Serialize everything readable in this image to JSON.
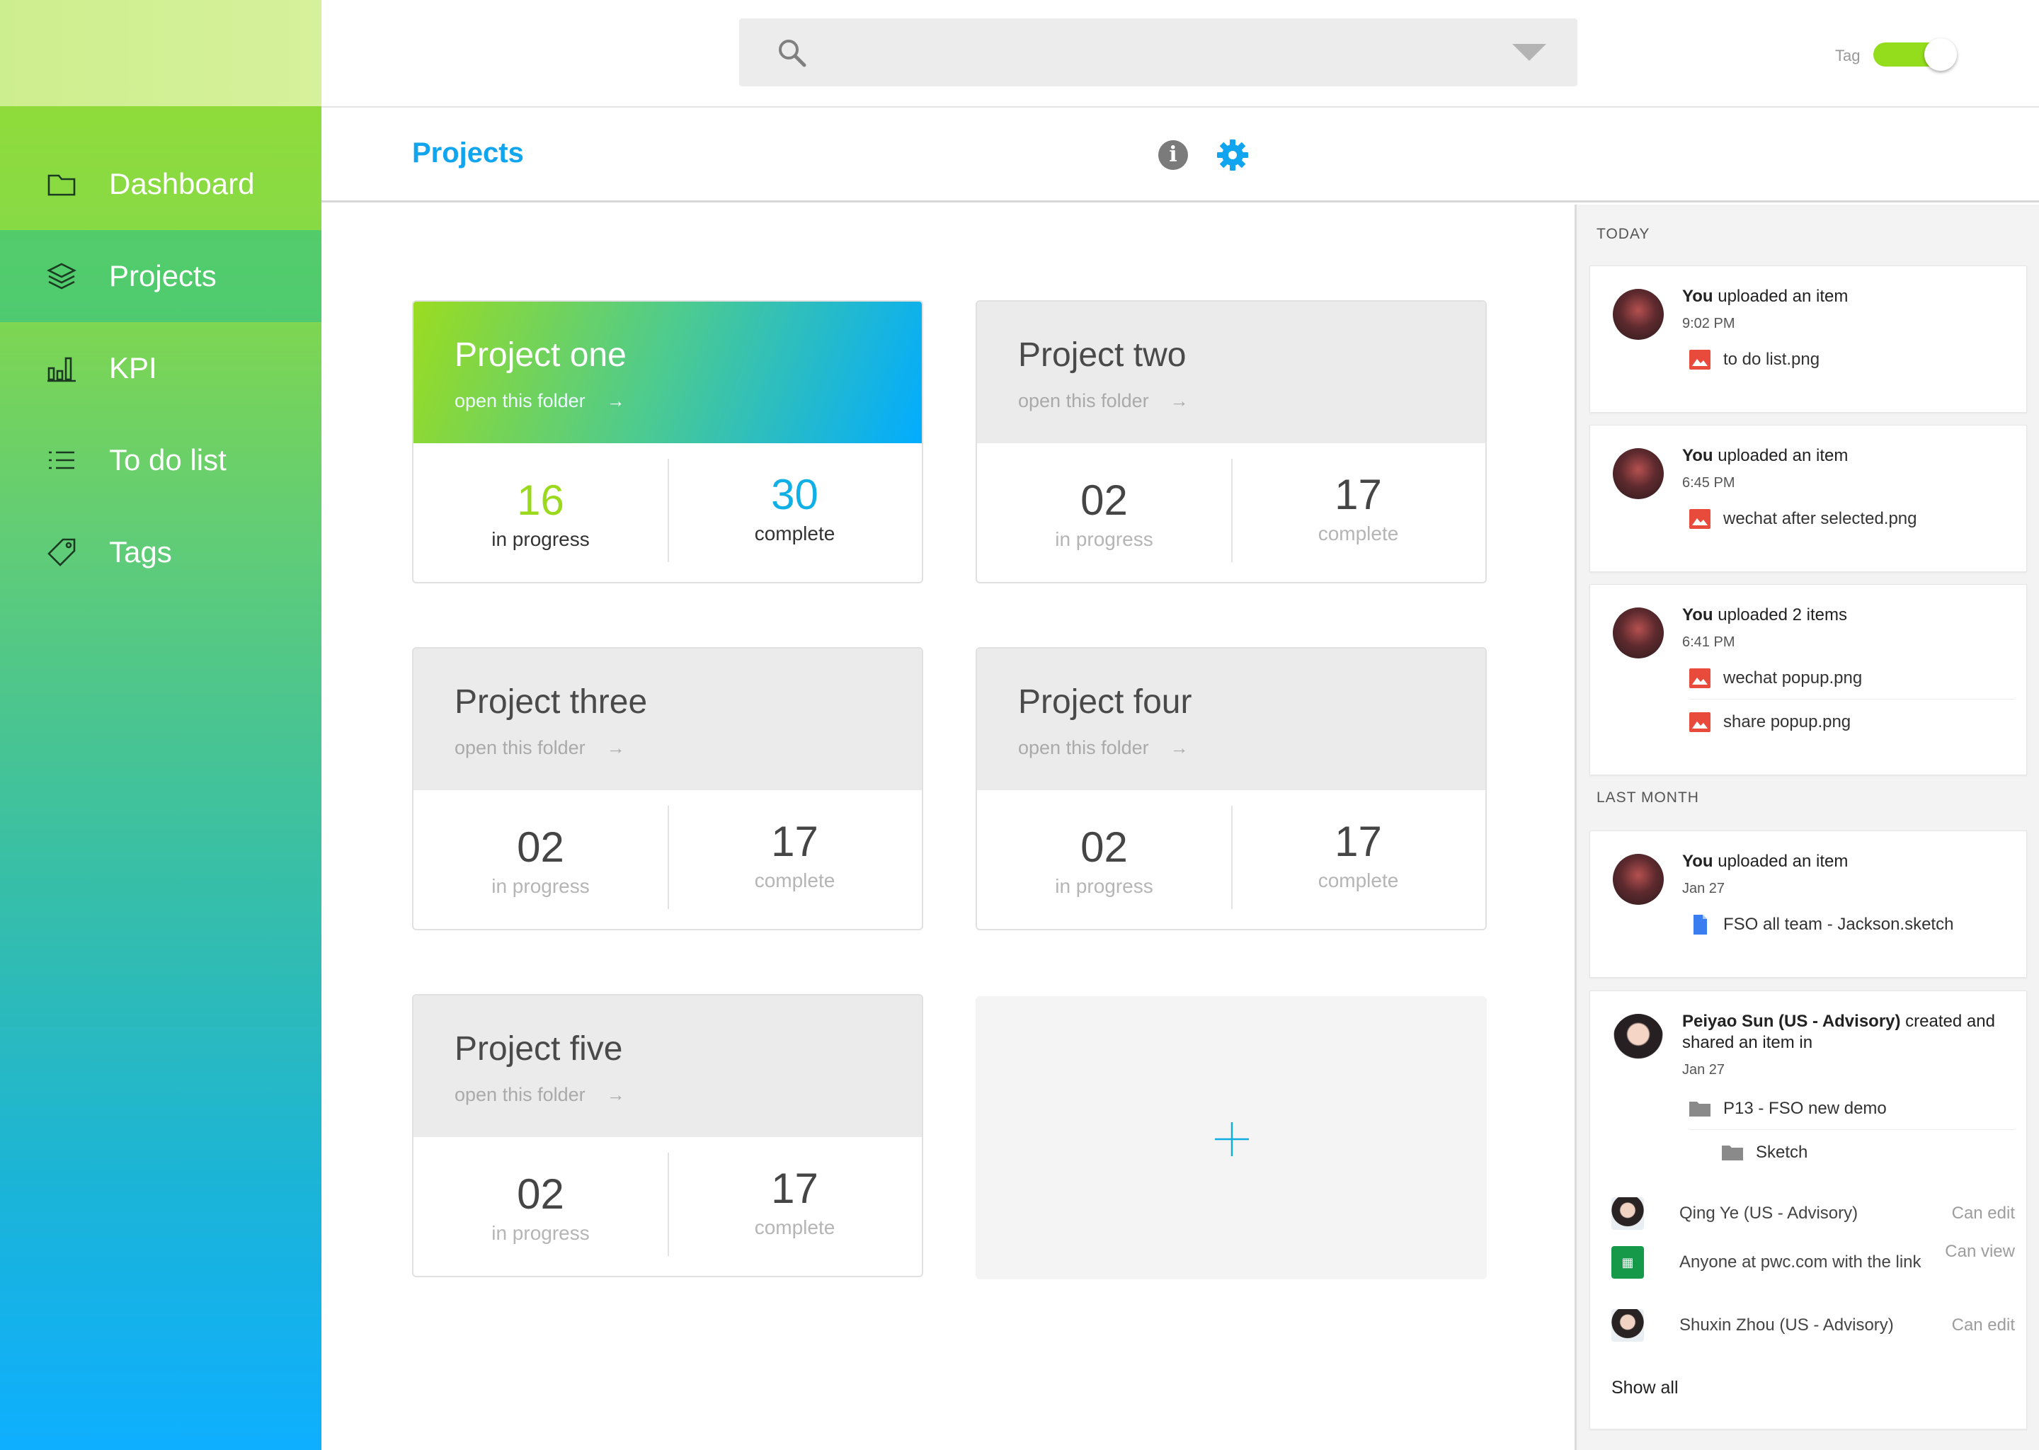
{
  "sidebar": {
    "items": [
      {
        "label": "Dashboard",
        "icon": "folder-icon"
      },
      {
        "label": "Projects",
        "icon": "layers-icon",
        "active": true
      },
      {
        "label": "KPI",
        "icon": "bar-chart-icon"
      },
      {
        "label": "To do list",
        "icon": "list-icon"
      },
      {
        "label": "Tags",
        "icon": "tag-icon"
      }
    ]
  },
  "topbar": {
    "search_placeholder": "",
    "tag_label": "Tag",
    "tag_toggle_on": true
  },
  "header": {
    "title": "Projects"
  },
  "projects": [
    {
      "title": "Project one",
      "link": "open this folder",
      "in_progress": "16",
      "in_progress_label": "in progress",
      "complete": "30",
      "complete_label": "complete",
      "featured": true
    },
    {
      "title": "Project two",
      "link": "open this folder",
      "in_progress": "02",
      "in_progress_label": "in progress",
      "complete": "17",
      "complete_label": "complete"
    },
    {
      "title": "Project three",
      "link": "open this folder",
      "in_progress": "02",
      "in_progress_label": "in progress",
      "complete": "17",
      "complete_label": "complete"
    },
    {
      "title": "Project four",
      "link": "open this folder",
      "in_progress": "02",
      "in_progress_label": "in progress",
      "complete": "17",
      "complete_label": "complete"
    },
    {
      "title": "Project five",
      "link": "open this folder",
      "in_progress": "02",
      "in_progress_label": "in progress",
      "complete": "17",
      "complete_label": "complete"
    }
  ],
  "colors": {
    "accent_blue": "#12a5ef",
    "accent_green": "#93dd1d",
    "in_progress_featured": "#9bd91c",
    "complete_featured": "#10b0e6",
    "file_image_red": "#e84a3c",
    "file_doc_blue": "#3a7df0",
    "folder_grey": "#8a8a8a"
  },
  "activity": {
    "today_label": "TODAY",
    "last_month_label": "LAST MONTH",
    "items": [
      {
        "actor": "You",
        "action": " uploaded an item",
        "time": "9:02 PM",
        "files": [
          "to do list.png"
        ]
      },
      {
        "actor": "You",
        "action": " uploaded an item",
        "time": "6:45 PM",
        "files": [
          "wechat after selected.png"
        ]
      },
      {
        "actor": "You",
        "action": " uploaded 2 items",
        "time": "6:41 PM",
        "files": [
          "wechat popup.png",
          "share popup.png"
        ]
      },
      {
        "actor": "You",
        "action": " uploaded an item",
        "time": "Jan 27",
        "files": [
          "FSO all team - Jackson.sketch"
        ]
      },
      {
        "actor": "Peiyao Sun (US - Advisory)",
        "action": " created and shared an item in",
        "time": "Jan 27",
        "folders": [
          "P13 - FSO new demo",
          "Sketch"
        ],
        "shared_with": [
          {
            "name": "Qing Ye (US - Advisory)",
            "permission": "Can edit"
          },
          {
            "name": "Anyone at pwc.com with the link",
            "permission": "Can view"
          },
          {
            "name": "Shuxin Zhou (US - Advisory)",
            "permission": "Can edit"
          }
        ],
        "show_all": "Show all"
      }
    ]
  }
}
